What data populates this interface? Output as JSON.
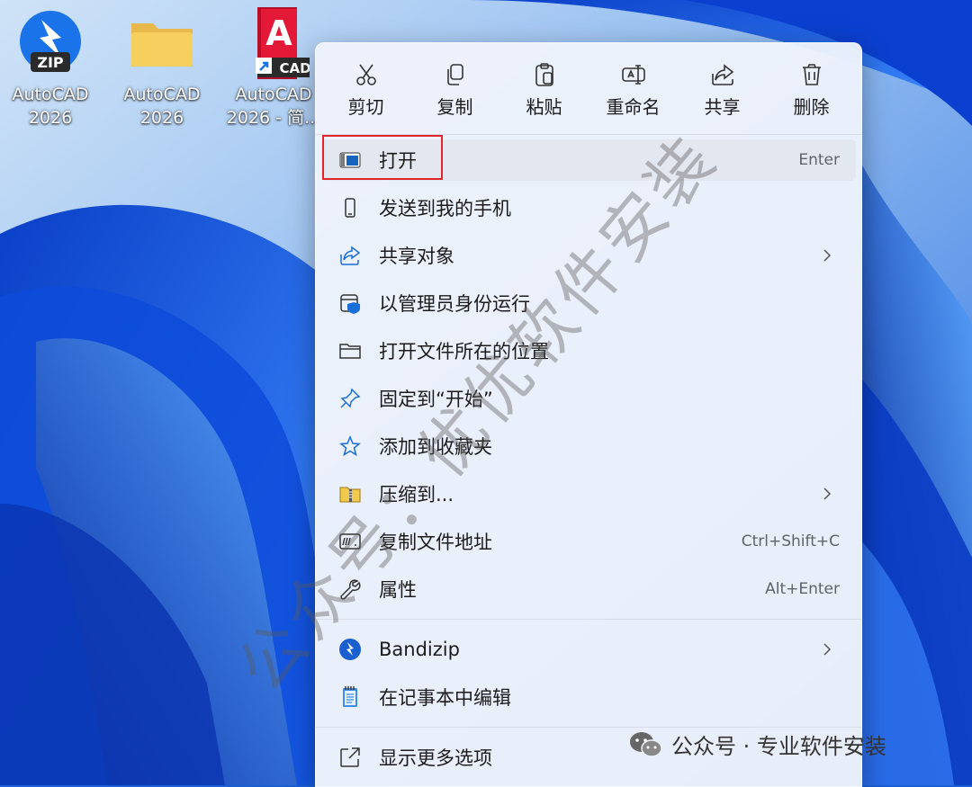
{
  "desktop": {
    "icons": [
      {
        "label_line1": "AutoCAD",
        "label_line2": "2026",
        "badge": "ZIP",
        "icon": "bandizip-zip-icon"
      },
      {
        "label_line1": "AutoCAD",
        "label_line2": "2026",
        "icon": "folder-icon"
      },
      {
        "label_line1": "AutoCAD",
        "label_line2": "2026 - 简...",
        "logo_letter": "A",
        "badge": "CAD",
        "icon": "autocad-shortcut-icon"
      }
    ]
  },
  "context_menu": {
    "toolbar": [
      {
        "label": "剪切",
        "icon": "scissors-icon"
      },
      {
        "label": "复制",
        "icon": "copy-icon"
      },
      {
        "label": "粘贴",
        "icon": "paste-icon"
      },
      {
        "label": "重命名",
        "icon": "rename-icon"
      },
      {
        "label": "共享",
        "icon": "share-icon"
      },
      {
        "label": "删除",
        "icon": "trash-icon"
      }
    ],
    "items": [
      {
        "label": "打开",
        "shortcut": "Enter",
        "icon": "open-window-icon",
        "highlighted": true
      },
      {
        "label": "发送到我的手机",
        "icon": "phone-icon"
      },
      {
        "label": "共享对象",
        "icon": "share-icon",
        "submenu": true
      },
      {
        "label": "以管理员身份运行",
        "icon": "admin-shield-icon"
      },
      {
        "label": "打开文件所在的位置",
        "icon": "folder-icon"
      },
      {
        "label": "固定到“开始”",
        "icon": "pin-icon"
      },
      {
        "label": "添加到收藏夹",
        "icon": "star-icon"
      },
      {
        "label": "压缩到...",
        "icon": "archive-icon",
        "submenu": true
      },
      {
        "label": "复制文件地址",
        "shortcut": "Ctrl+Shift+C",
        "icon": "copy-path-icon"
      },
      {
        "label": "属性",
        "shortcut": "Alt+Enter",
        "icon": "wrench-icon"
      }
    ],
    "apps": [
      {
        "label": "Bandizip",
        "icon": "bandizip-icon",
        "submenu": true
      },
      {
        "label": "在记事本中编辑",
        "icon": "notepad-icon"
      }
    ],
    "more": {
      "label": "显示更多选项",
      "icon": "more-options-icon"
    }
  },
  "watermark": {
    "text": "公众号：优优软件安装"
  },
  "footer_watermark": {
    "text": "公众号 · 专业软件安装",
    "icon": "wechat-icon"
  },
  "colors": {
    "accent": "#1a73e8",
    "highlight_box": "#e0262a",
    "wallpaper": "#1b5fd6"
  }
}
